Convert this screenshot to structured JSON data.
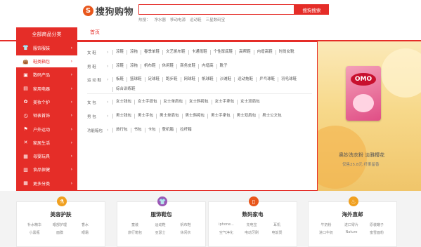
{
  "header": {
    "logo_mark": "S",
    "logo_text": "搜狗购物",
    "search_placeholder": "",
    "search_button": "搜狗搜索",
    "hot_label": "热搜：",
    "hot_terms": [
      "净水器",
      "移动电源",
      "运动鞋",
      "三星数码宝"
    ]
  },
  "nav": {
    "all_categories": "全部商品分类",
    "home_tab": "首页"
  },
  "sidebar": {
    "items": [
      {
        "label": "服饰服装",
        "icon": "shirt-icon",
        "glyph": "👕"
      },
      {
        "label": "鞋类箱包",
        "icon": "bag-icon",
        "glyph": "👜",
        "active": true
      },
      {
        "label": "数码产品",
        "icon": "camera-icon",
        "glyph": "▣"
      },
      {
        "label": "家用电器",
        "icon": "appliance-icon",
        "glyph": "▤"
      },
      {
        "label": "美妆个护",
        "icon": "cosmetics-icon",
        "glyph": "✿"
      },
      {
        "label": "钟表首饰",
        "icon": "watch-icon",
        "glyph": "◷"
      },
      {
        "label": "户外运动",
        "icon": "outdoor-icon",
        "glyph": "⚑"
      },
      {
        "label": "家居生活",
        "icon": "home-icon",
        "glyph": "✕"
      },
      {
        "label": "母婴玩具",
        "icon": "baby-icon",
        "glyph": "▦"
      },
      {
        "label": "食品保健",
        "icon": "food-icon",
        "glyph": "▥"
      },
      {
        "label": "更多分类",
        "icon": "more-icon",
        "glyph": "▦"
      }
    ],
    "arrow": "›"
  },
  "panel": {
    "arrow": "›",
    "groups": [
      {
        "label": "女  鞋",
        "items": [
          "凉鞋",
          "凉拖",
          "春季单鞋",
          "文艺帆布鞋",
          "卡通雨鞋",
          "个性厚底鞋",
          "高帮鞋",
          "内增高鞋",
          "时尚女靴"
        ]
      },
      {
        "label": "男  鞋",
        "items": [
          "凉鞋",
          "凉拖",
          "帆布鞋",
          "休闲鞋",
          "商务皮鞋",
          "内增高",
          "靴子"
        ]
      },
      {
        "label": "运 动 鞋",
        "items": [
          "板鞋",
          "篮球鞋",
          "足球鞋",
          "跑步鞋",
          "网球鞋",
          "帆球鞋",
          "沙滩鞋",
          "运动拖鞋",
          "乒乓球鞋",
          "羽毛球鞋",
          "综合训练鞋"
        ]
      },
      {
        "label": "女  包",
        "items": [
          "女士钱包",
          "女士手提包",
          "女士单肩包",
          "女士斜挎包",
          "女士手拿包",
          "女士双肩包"
        ]
      },
      {
        "label": "男  包",
        "items": [
          "男士钱包",
          "男士手包",
          "男士单肩包",
          "男士斜挎包",
          "男士手拿包",
          "男士双肩包",
          "男士公文包"
        ]
      },
      {
        "label": "功能箱包",
        "items": [
          "旅行包",
          "书包",
          "卡包",
          "登机箱",
          "拉杆箱"
        ]
      }
    ]
  },
  "banner": {
    "brand": "OMO",
    "title": "奥妙洗衣粉 淡雅樱花",
    "subtitle": "仅售25.8元 纤柔留香"
  },
  "bottom": {
    "blocks": [
      {
        "title": "美容护肤",
        "icon": "flask-icon",
        "glyph": "⚗",
        "color": "#f0a020",
        "links": [
          "补水精华",
          "眼部护理",
          "香水",
          "小黑瓶",
          "面膜",
          "眼霜"
        ]
      },
      {
        "title": "服饰鞋包",
        "icon": "shirt-icon",
        "glyph": "👕",
        "color": "#9b59b6",
        "links": [
          "童装",
          "运动鞋",
          "帆布鞋",
          "旅行箱包",
          "亚瑟士",
          "休闲衣"
        ]
      },
      {
        "title": "数码家电",
        "icon": "phone-icon",
        "glyph": "▯",
        "color": "#e8561b",
        "links": [
          "iphone...",
          "充电宝",
          "耳机",
          "空气净化",
          "电动牙刷",
          "电饭煲"
        ]
      },
      {
        "title": "海外直邮",
        "icon": "globe-icon",
        "glyph": "♨",
        "color": "#f0a020",
        "links": [
          "牛奶粉",
          "进口零片",
          "原装罐子",
          "进口牛奶",
          "Nature",
          "蜜雪面粉"
        ]
      }
    ]
  }
}
